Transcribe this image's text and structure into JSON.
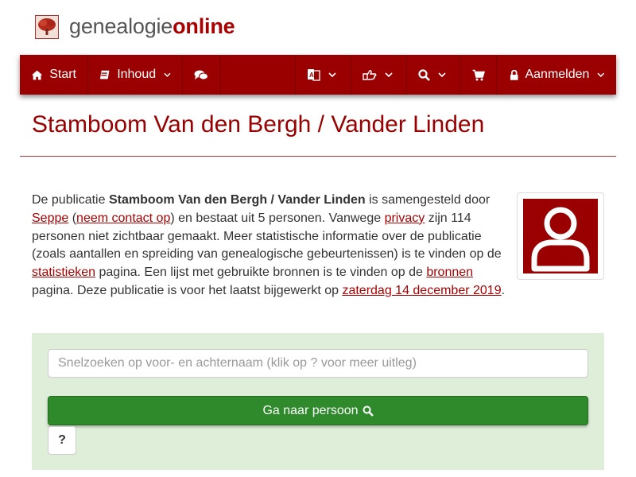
{
  "site": {
    "logo_prefix": "genealogie",
    "logo_suffix": "online"
  },
  "nav": {
    "start": "Start",
    "contents": "Inhoud",
    "login": "Aanmelden"
  },
  "page": {
    "title": "Stamboom Van den Bergh / Vander Linden"
  },
  "intro": {
    "t1": "De publicatie ",
    "pub_name": "Stamboom Van den Bergh / Vander Linden",
    "t2": " is samengesteld door ",
    "author": "Seppe",
    "t3": " (",
    "contact": "neem contact op",
    "t4": ") en bestaat uit 5 personen. Vanwege ",
    "privacy": "privacy",
    "t5": " zijn 114 personen niet zichtbaar gemaakt. Meer statistische informatie over de publicatie (zoals aantallen en spreiding van genealogische gebeurtenissen) is te vinden op de ",
    "stats": "statistieken",
    "t6": " pagina. Een lijst met gebruikte bronnen is te vinden op de ",
    "sources": "bronnen",
    "t7": " pagina. Deze publicatie is voor het laatst bijgewerkt op ",
    "date": "zaterdag 14 december 2019",
    "t8": "."
  },
  "search": {
    "placeholder": "Snelzoeken op voor- en achternaam (klik op ? voor meer uitleg)",
    "button": "Ga naar persoon",
    "help": "?"
  },
  "colors": {
    "brand": "#9b0000",
    "panel": "#dfeed9",
    "button": "#2f8a2c"
  }
}
